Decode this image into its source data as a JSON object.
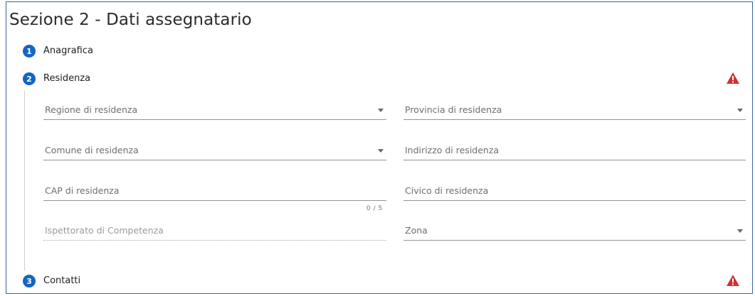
{
  "section": {
    "title": "Sezione 2 - Dati assegnatario"
  },
  "steps": [
    {
      "number": "1",
      "label": "Anagrafica",
      "warning": false
    },
    {
      "number": "2",
      "label": "Residenza",
      "warning": true,
      "warning_icon": "warning-icon"
    },
    {
      "number": "3",
      "label": "Contatti",
      "warning": true,
      "warning_icon": "warning-icon"
    }
  ],
  "residenza": {
    "regione": {
      "label": "Regione di residenza",
      "type": "select",
      "value": ""
    },
    "provincia": {
      "label": "Provincia di residenza",
      "type": "select",
      "value": ""
    },
    "comune": {
      "label": "Comune di residenza",
      "type": "select",
      "value": ""
    },
    "indirizzo": {
      "label": "Indirizzo di residenza",
      "type": "text",
      "value": ""
    },
    "cap": {
      "label": "CAP di residenza",
      "type": "text",
      "value": "",
      "counter": "0 / 5"
    },
    "civico": {
      "label": "Civico di residenza",
      "type": "text",
      "value": ""
    },
    "ispettorato": {
      "label": "Ispettorato di Competenza",
      "type": "text",
      "value": "",
      "disabled": true
    },
    "zona": {
      "label": "Zona",
      "type": "select",
      "value": ""
    }
  },
  "colors": {
    "accent": "#1565c0",
    "warning": "#d32f2f",
    "panel_border": "#2f62a8"
  }
}
